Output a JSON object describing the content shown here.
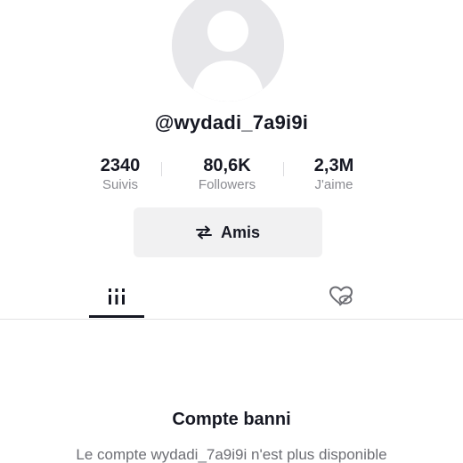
{
  "profile": {
    "username": "@wydadi_7a9i9i",
    "avatar_icon": "default-avatar-icon"
  },
  "stats": [
    {
      "value": "2340",
      "label": "Suivis"
    },
    {
      "value": "80,6K",
      "label": "Followers"
    },
    {
      "value": "2,3M",
      "label": "J'aime"
    }
  ],
  "friends_button": {
    "label": "Amis",
    "icon": "swap-arrows-icon"
  },
  "tabs": [
    {
      "icon": "grid-icon",
      "active": true
    },
    {
      "icon": "liked-hidden-heart-icon",
      "active": false
    }
  ],
  "banned": {
    "title": "Compte banni",
    "message": "Le compte wydadi_7a9i9i n'est plus disponible"
  },
  "colors": {
    "text": "#161823",
    "muted": "#8a8b91",
    "button_bg": "#f1f1f2",
    "avatar_bg": "#e7e7ea"
  }
}
